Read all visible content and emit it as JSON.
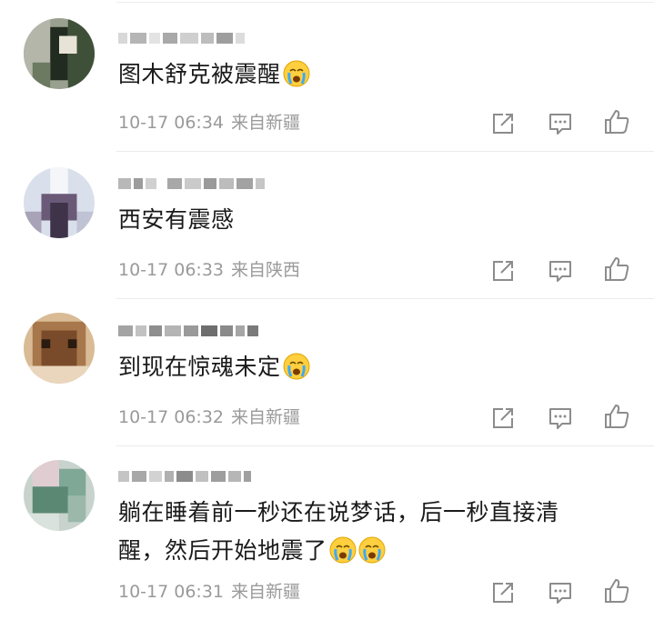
{
  "comments": [
    {
      "text": "图木舒克被震醒",
      "emoji": "crying-face",
      "time": "10-17 06:34",
      "location": "来自新疆",
      "avatar_colors": [
        "#3b4a35",
        "#8a8a78",
        "#1e2a1e",
        "#a6a89a"
      ]
    },
    {
      "text": "西安有震感",
      "emoji": "",
      "time": "10-17 06:33",
      "location": "来自陕西",
      "avatar_colors": [
        "#cfd6e6",
        "#5a4a6a",
        "#eef1f7",
        "#8c7f96"
      ]
    },
    {
      "text": "到现在惊魂未定",
      "emoji": "crying-face",
      "time": "10-17 06:32",
      "location": "来自新疆",
      "avatar_colors": [
        "#c7a27a",
        "#8b5a35",
        "#e8d2b6",
        "#6a4328"
      ]
    },
    {
      "text_line1": "躺在睡着前一秒还在说梦话，后一秒直接清",
      "text_line2": "醒，然后开始地震了",
      "emoji": "crying-face",
      "emoji_count": 2,
      "time": "10-17 06:31",
      "location": "来自新疆",
      "avatar_colors": [
        "#b9c8c0",
        "#6f9a86",
        "#d9c6c9",
        "#4d7a68"
      ]
    }
  ],
  "icons": {
    "repost": "share-arrow-icon",
    "comment": "comment-bubble-icon",
    "like": "thumbs-up-icon"
  },
  "colors": {
    "text": "#1a1a1a",
    "meta": "#9a9a9a",
    "icon": "#8c8c8c"
  }
}
